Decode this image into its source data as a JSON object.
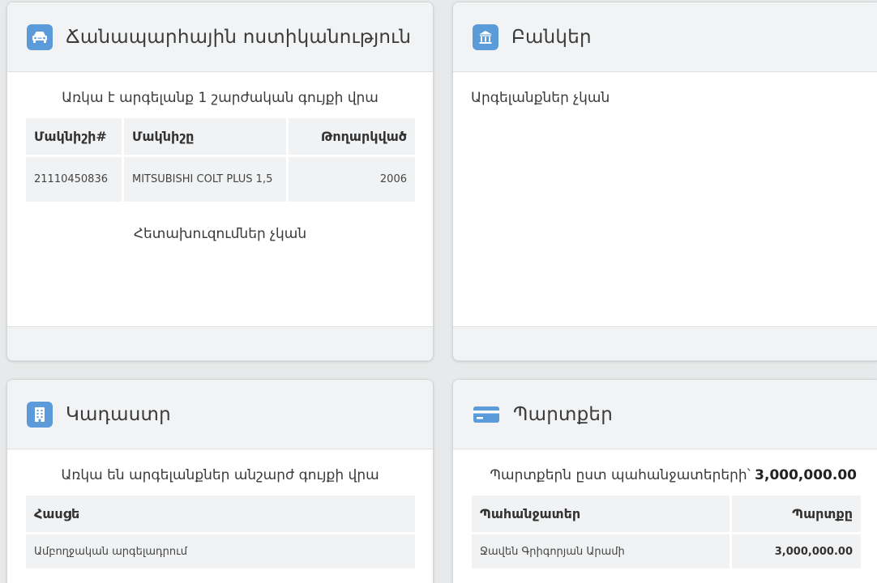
{
  "traffic_police": {
    "title": "Ճանապարհային ոստիկանություն",
    "summary": "Առկա է արգելանք 1 շարժական գույքի վրա",
    "columns": [
      "Մակնիշի#",
      "Մակնիշը",
      "Թողարկված"
    ],
    "rows": [
      {
        "number": "21110450836",
        "model": "MITSUBISHI COLT PLUS 1,5",
        "year": "2006"
      }
    ],
    "investigations": "Հետախուզումներ չկան"
  },
  "banks": {
    "title": "Բանկեր",
    "summary": "Արգելանքներ չկան"
  },
  "cadastre": {
    "title": "Կադաստր",
    "summary": "Առկա են արգելանքներ անշարժ գույքի վրա",
    "columns": [
      "Հասցե"
    ],
    "rows": [
      {
        "address": "Ամբողջական արգելադրում"
      }
    ]
  },
  "debts": {
    "title": "Պարտքեր",
    "summary_label": "Պարտքերն ըստ պահանջատերերի՝",
    "summary_total": "3,000,000.00",
    "columns": [
      "Պահանջատեր",
      "Պարտքը"
    ],
    "rows": [
      {
        "creditor": "Ջավեն Գրիգորյան Արամի",
        "amount": "3,000,000.00"
      }
    ]
  },
  "colors": {
    "icon_blue": "#5b9bd9",
    "header_bg": "#f2f3f4",
    "page_bg": "#e8e9ea"
  },
  "icons": {
    "traffic_police": "car-icon",
    "banks": "bank-icon",
    "cadastre": "building-icon",
    "debts": "credit-card-icon"
  }
}
